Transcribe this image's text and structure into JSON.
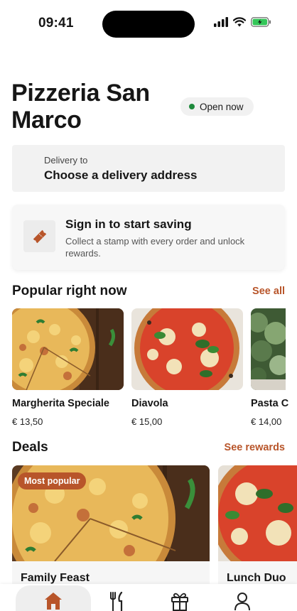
{
  "status_bar": {
    "time": "09:41"
  },
  "restaurant": {
    "name": "Pizzeria San Marco",
    "status": "Open now"
  },
  "delivery": {
    "label": "Delivery to",
    "value": "Choose a delivery address"
  },
  "signin_card": {
    "title": "Sign in to start saving",
    "subtitle": "Collect a stamp with every order and unlock rewards.",
    "icon": "ticket-icon"
  },
  "popular": {
    "title": "Popular right now",
    "link": "See all",
    "items": [
      {
        "name": "Margherita Speciale",
        "price": "€ 13,50"
      },
      {
        "name": "Diavola",
        "price": "€ 15,00"
      },
      {
        "name": "Pasta C",
        "price": "€ 14,00"
      }
    ]
  },
  "deals": {
    "title": "Deals",
    "link": "See rewards",
    "items": [
      {
        "name": "Family Feast",
        "badge": "Most popular"
      },
      {
        "name": "Lunch Duo",
        "badge": ""
      }
    ]
  },
  "bottom_nav": {
    "items": [
      {
        "icon": "home-icon",
        "active": true
      },
      {
        "icon": "fork-knife-icon",
        "active": false
      },
      {
        "icon": "gift-icon",
        "active": false
      },
      {
        "icon": "profile-icon",
        "active": false
      }
    ]
  },
  "colors": {
    "accent": "#b8552a",
    "open": "#1e8a3c",
    "text": "#161616"
  }
}
